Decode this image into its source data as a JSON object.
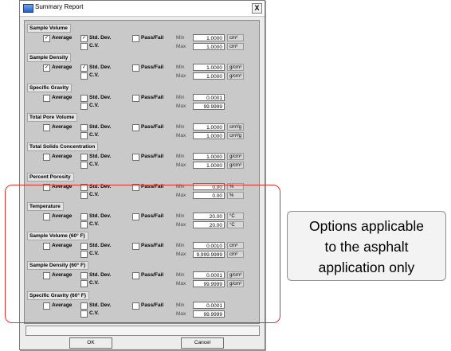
{
  "window": {
    "title": "Summary Report",
    "close_label": "X"
  },
  "labels": {
    "average": "Average",
    "std_dev": "Std. Dev.",
    "cv": "C.V.",
    "pass_fail": "Pass/Fail",
    "min": "Min",
    "max": "Max"
  },
  "sections": [
    {
      "name": "Sample Volume",
      "average": true,
      "std_dev": true,
      "cv": false,
      "pass_fail": false,
      "min": "1.0000",
      "max": "1.0000",
      "min_unit": "cm³",
      "max_unit": "cm³"
    },
    {
      "name": "Sample Density",
      "average": true,
      "std_dev": true,
      "cv": false,
      "pass_fail": false,
      "min": "1.0000",
      "max": "1.0000",
      "min_unit": "g/cm³",
      "max_unit": "g/cm³"
    },
    {
      "name": "Specific Gravity",
      "average": false,
      "std_dev": false,
      "cv": false,
      "pass_fail": false,
      "min": "0.0001",
      "max": "99.9999",
      "min_unit": "",
      "max_unit": ""
    },
    {
      "name": "Total Pore Volume",
      "average": false,
      "std_dev": false,
      "cv": false,
      "pass_fail": false,
      "min": "1.0000",
      "max": "1.0000",
      "min_unit": "cm³/g",
      "max_unit": "cm³/g"
    },
    {
      "name": "Total Solids Concentration",
      "average": false,
      "std_dev": false,
      "cv": false,
      "pass_fail": false,
      "min": "1.0000",
      "max": "1.0000",
      "min_unit": "g/cm³",
      "max_unit": "g/cm³"
    },
    {
      "name": "Percent Porosity",
      "average": false,
      "std_dev": false,
      "cv": false,
      "pass_fail": false,
      "min": "0.00",
      "max": "0.00",
      "min_unit": "%",
      "max_unit": "%"
    },
    {
      "name": "Temperature",
      "average": false,
      "std_dev": false,
      "cv": false,
      "pass_fail": false,
      "min": "20.00",
      "max": "20.00",
      "min_unit": "°C",
      "max_unit": "°C"
    },
    {
      "name": "Sample Volume (60° F)",
      "average": false,
      "std_dev": false,
      "cv": false,
      "pass_fail": false,
      "min": "0.0010",
      "max": "9,999.9999",
      "min_unit": "cm³",
      "max_unit": "cm³"
    },
    {
      "name": "Sample Density (60° F)",
      "average": false,
      "std_dev": false,
      "cv": false,
      "pass_fail": false,
      "min": "0.0001",
      "max": "99.9999",
      "min_unit": "g/cm³",
      "max_unit": "g/cm³"
    },
    {
      "name": "Specific Gravity (60° F)",
      "average": false,
      "std_dev": false,
      "cv": false,
      "pass_fail": false,
      "min": "0.0001",
      "max": "99.9999",
      "min_unit": "",
      "max_unit": ""
    }
  ],
  "buttons": {
    "ok": "OK",
    "cancel": "Cancel"
  },
  "callout": {
    "lines": [
      "Options applicable",
      "to the asphalt",
      "application only"
    ]
  },
  "colors": {
    "highlight": "#d9342b"
  }
}
